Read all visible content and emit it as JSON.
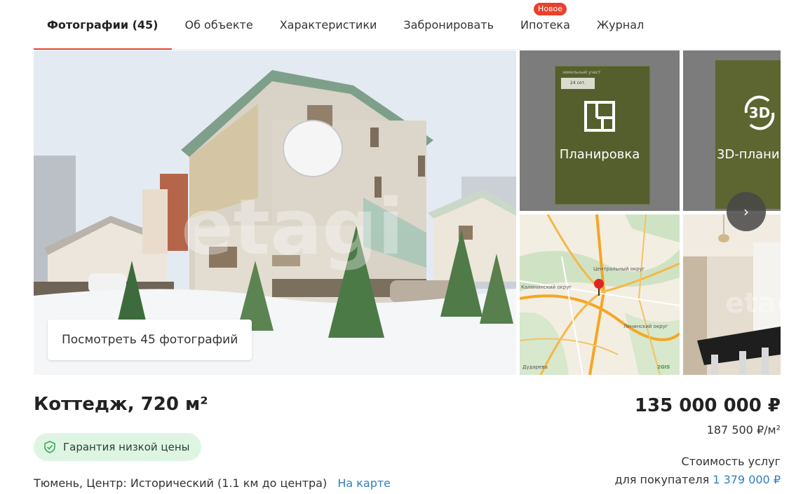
{
  "tabs": [
    {
      "label": "Фотографии (45)",
      "active": true
    },
    {
      "label": "Об объекте"
    },
    {
      "label": "Характеристики"
    },
    {
      "label": "Забронировать"
    },
    {
      "label": "Ипотека",
      "badge": "Новое"
    },
    {
      "label": "Журнал"
    }
  ],
  "gallery": {
    "view_all_label": "Посмотреть 45 фотографий",
    "plan_label": "Планировка",
    "plan_card_heading": "земельный участ",
    "plan_card_value": "24 сот.",
    "plan3d_label": "3D-планир",
    "plan3d_badge": "3D",
    "watermark": "etagi",
    "next_icon": "chevron-right-icon",
    "map_labels": {
      "district_central": "Центральный округ",
      "district_kalininsky": "Калининский округ",
      "district_leninsky": "Ленинский округ",
      "street_dudareva": "Дударева",
      "provider": "2GIS"
    }
  },
  "listing": {
    "title": "Коттедж, 720 м²",
    "guarantee": "Гарантия низкой цены",
    "address": "Тюмень, Центр: Исторический (1.1 км до центра)",
    "map_link": "На карте",
    "price": "135 000 000 ₽",
    "price_per_m2": "187 500 ₽/м²",
    "service_cost_line1": "Стоимость услуг",
    "service_cost_line2": "для покупателя",
    "service_cost_value": "1 379 000 ₽"
  },
  "colors": {
    "accent": "#e8412c",
    "link": "#2f7ec4",
    "badge_bg": "#dff5e4",
    "plan_green": "#555f2e"
  }
}
